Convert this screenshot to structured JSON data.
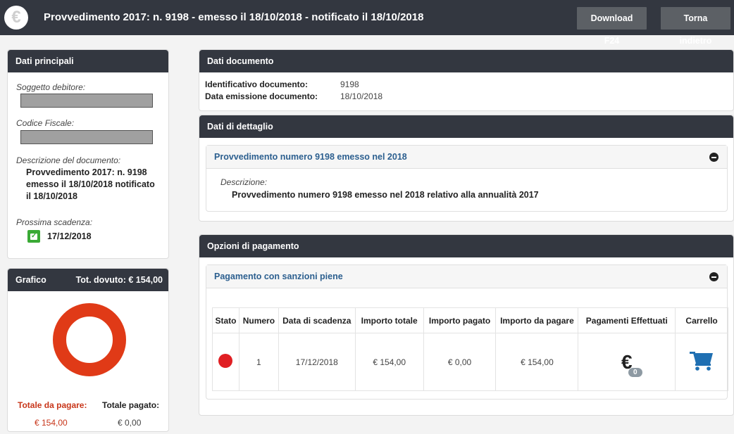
{
  "header": {
    "logo_symbol": "€",
    "title": "Provvedimento 2017: n. 9198 - emesso il 18/10/2018 - notificato il 18/10/2018",
    "download_label": "Download F24",
    "back_label": "Torna indietro"
  },
  "main_data": {
    "title": "Dati principali",
    "debtor_label": "Soggetto debitore:",
    "fiscal_code_label": "Codice Fiscale:",
    "description_label": "Descrizione del documento:",
    "description_line1": "Provvedimento 2017: n. 9198",
    "description_line2": "emesso il 18/10/2018 notificato",
    "description_line3": "il 18/10/2018",
    "next_due_label": "Prossima scadenza:",
    "next_due_date": "17/12/2018"
  },
  "chart": {
    "title": "Grafico",
    "total_due": "Tot. dovuto: € 154,00",
    "to_pay_label": "Totale da pagare:",
    "paid_label": "Totale pagato:",
    "to_pay_value": "€ 154,00",
    "paid_value": "€ 0,00",
    "color_to_pay": "#e03a17"
  },
  "document": {
    "title": "Dati documento",
    "id_label": "Identificativo documento:",
    "id_value": "9198",
    "date_label": "Data emissione documento:",
    "date_value": "18/10/2018"
  },
  "detail": {
    "title": "Dati di dettaglio",
    "panel_title": "Provvedimento numero 9198 emesso nel 2018",
    "desc_label": "Descrizione:",
    "desc_value": "Provvedimento numero 9198 emesso nel 2018 relativo alla annualità 2017"
  },
  "payment": {
    "title": "Opzioni di pagamento",
    "panel_title": "Pagamento con sanzioni piene",
    "columns": [
      "Stato",
      "Numero",
      "Data di scadenza",
      "Importo totale",
      "Importo pagato",
      "Importo da pagare",
      "Pagamenti Effettuati",
      "Carrello"
    ],
    "row": {
      "status_color": "#e01f23",
      "number": "1",
      "due_date": "17/12/2018",
      "total": "€ 154,00",
      "paid": "€ 0,00",
      "to_pay": "€ 154,00",
      "payments_symbol": "€",
      "payments_count": "0"
    }
  }
}
